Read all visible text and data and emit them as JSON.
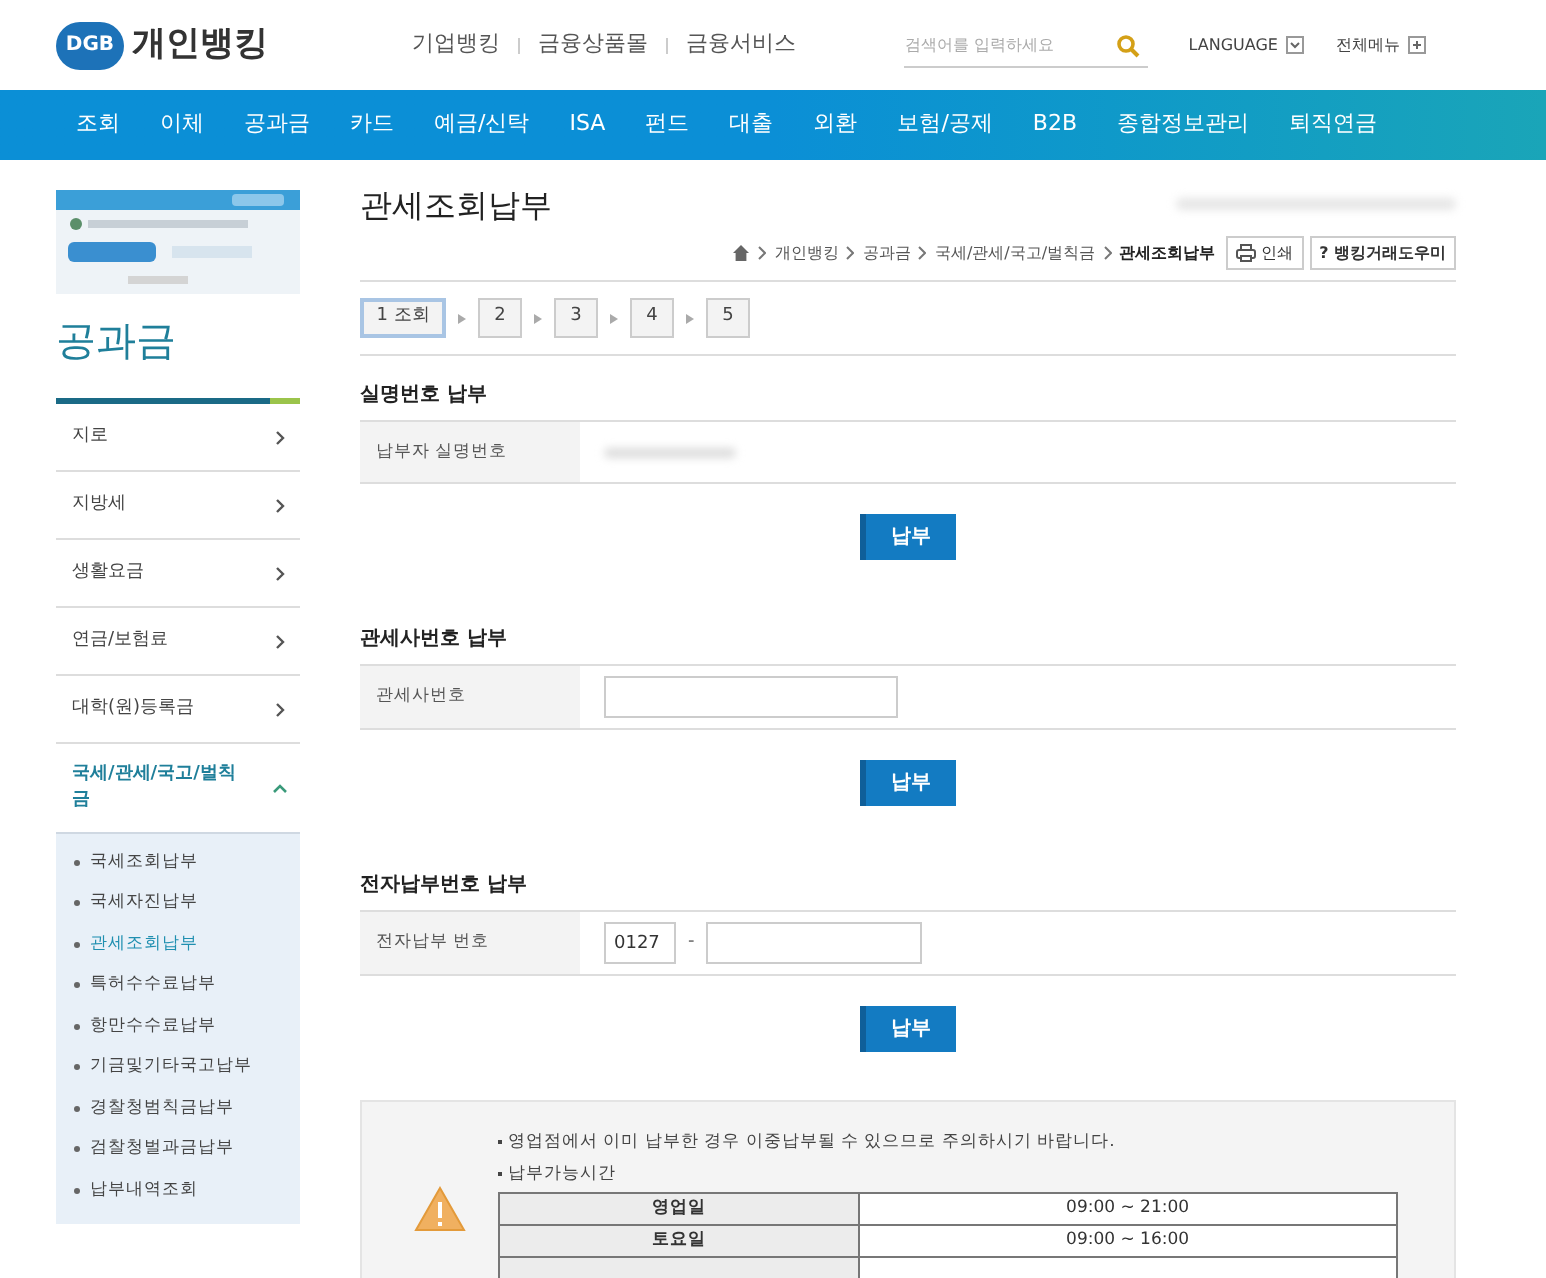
{
  "header": {
    "logo_mark": "DGB",
    "logo_text": "개인뱅킹",
    "top_links": [
      "기업뱅킹",
      "금융상품몰",
      "금융서비스"
    ],
    "search": {
      "placeholder": "검색어를 입력하세요"
    },
    "language": "LANGUAGE",
    "all_menu": "전체메뉴"
  },
  "nav": [
    "조회",
    "이체",
    "공과금",
    "카드",
    "예금/신탁",
    "ISA",
    "펀드",
    "대출",
    "외환",
    "보험/공제",
    "B2B",
    "종합정보관리",
    "퇴직연금"
  ],
  "sidebar": {
    "title": "공과금",
    "items": [
      {
        "label": "지로",
        "expanded": false
      },
      {
        "label": "지방세",
        "expanded": false
      },
      {
        "label": "생활요금",
        "expanded": false
      },
      {
        "label": "연금/보험료",
        "expanded": false
      },
      {
        "label": "대학(원)등록금",
        "expanded": false
      },
      {
        "label": "국세/관세/국고/벌칙금",
        "expanded": true,
        "children": [
          {
            "label": "국세조회납부",
            "selected": false
          },
          {
            "label": "국세자진납부",
            "selected": false
          },
          {
            "label": "관세조회납부",
            "selected": true
          },
          {
            "label": "특허수수료납부",
            "selected": false
          },
          {
            "label": "항만수수료납부",
            "selected": false
          },
          {
            "label": "기금및기타국고납부",
            "selected": false
          },
          {
            "label": "경찰청범칙금납부",
            "selected": false
          },
          {
            "label": "검찰청벌과금납부",
            "selected": false
          },
          {
            "label": "납부내역조회",
            "selected": false
          }
        ]
      }
    ]
  },
  "page": {
    "title": "관세조회납부",
    "breadcrumb": [
      "개인뱅킹",
      "공과금",
      "국세/관세/국고/벌칙금",
      "관세조회납부"
    ],
    "print_button": "인쇄",
    "help_button": "? 뱅킹거래도우미"
  },
  "steps": [
    {
      "label": "1 조회",
      "selected": true
    },
    {
      "label": "2",
      "selected": false
    },
    {
      "label": "3",
      "selected": false
    },
    {
      "label": "4",
      "selected": false
    },
    {
      "label": "5",
      "selected": false
    }
  ],
  "sections": [
    {
      "title": "실명번호 납부",
      "kind": "masked",
      "field_label": "납부자 실명번호",
      "button": "납부"
    },
    {
      "title": "관세사번호 납부",
      "kind": "input",
      "field_label": "관세사번호",
      "button": "납부"
    },
    {
      "title": "전자납부번호 납부",
      "kind": "split",
      "field_label": "전자납부 번호",
      "prefix_value": "0127",
      "separator": "-",
      "button": "납부"
    }
  ],
  "notice": {
    "lines": [
      "영업점에서 이미 납부한 경우 이중납부될 수 있으므로 주의하시기 바랍니다.",
      "납부가능시간"
    ],
    "hours": [
      {
        "day": "영업일",
        "time": "09:00 ~ 21:00"
      },
      {
        "day": "토요일",
        "time": "09:00 ~ 16:00"
      }
    ]
  }
}
